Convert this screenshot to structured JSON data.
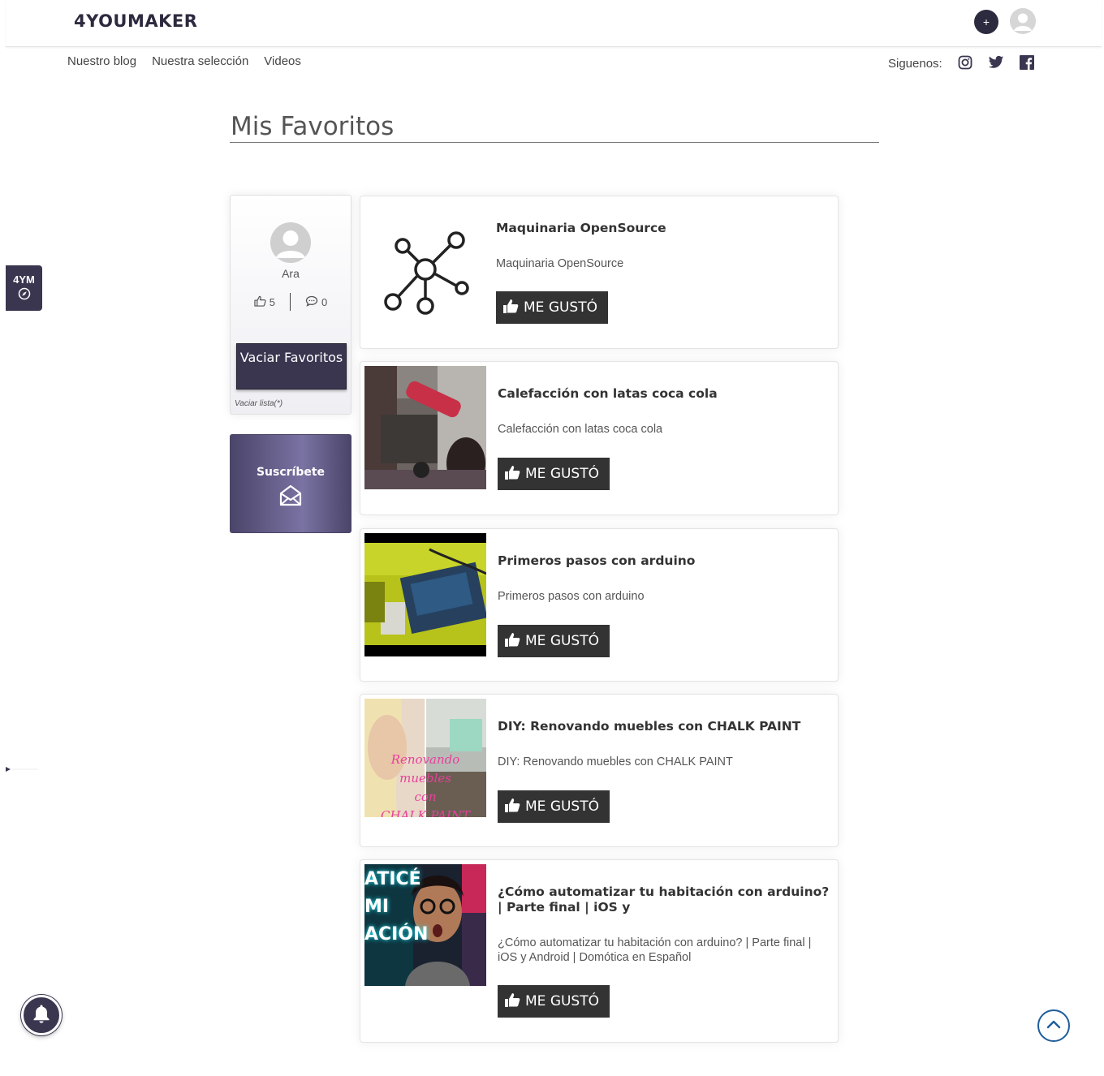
{
  "header": {
    "logo": "4YOUMAKER",
    "add_label": "+"
  },
  "nav": {
    "items": [
      "Nuestro blog",
      "Nuestra selección",
      "Videos"
    ],
    "follow_label": "Siguenos:",
    "social": [
      "instagram-icon",
      "twitter-icon",
      "facebook-icon"
    ]
  },
  "page": {
    "title": "Mis Favoritos"
  },
  "side_tab": {
    "label": "4YM"
  },
  "profile": {
    "name": "Ara",
    "likes": "5",
    "comments": "0",
    "clear_button": "Vaciar Favoritos",
    "clear_note": "Vaciar lista(*)"
  },
  "subscribe": {
    "label": "Suscríbete"
  },
  "favorites": [
    {
      "title": "Maquinaria OpenSource",
      "description": "Maquinaria OpenSource",
      "like_label": "ME GUSTÓ"
    },
    {
      "title": "Calefacción con latas coca cola",
      "description": "Calefacción con latas coca cola",
      "like_label": "ME GUSTÓ"
    },
    {
      "title": "Primeros pasos con arduino",
      "description": "Primeros pasos con arduino",
      "like_label": "ME GUSTÓ"
    },
    {
      "title": "DIY: Renovando muebles con CHALK PAINT",
      "description": "DIY: Renovando muebles con CHALK PAINT",
      "like_label": "ME GUSTÓ",
      "thumb_text": [
        "Renovando",
        "muebles",
        "con",
        "CHALK PAINT"
      ]
    },
    {
      "title": "¿Cómo automatizar tu habitación con arduino? | Parte final | iOS y",
      "description": "¿Cómo automatizar tu habitación con arduino? | Parte final | iOS y Android | Domótica en Español",
      "like_label": "ME GUSTÓ",
      "thumb_text": [
        "ATICÉ",
        "MI",
        "ACIÓN"
      ]
    }
  ],
  "colors": {
    "brand_dark": "#3a3650",
    "like_button": "#333333",
    "scroll_top_border": "#1e5d9a"
  }
}
